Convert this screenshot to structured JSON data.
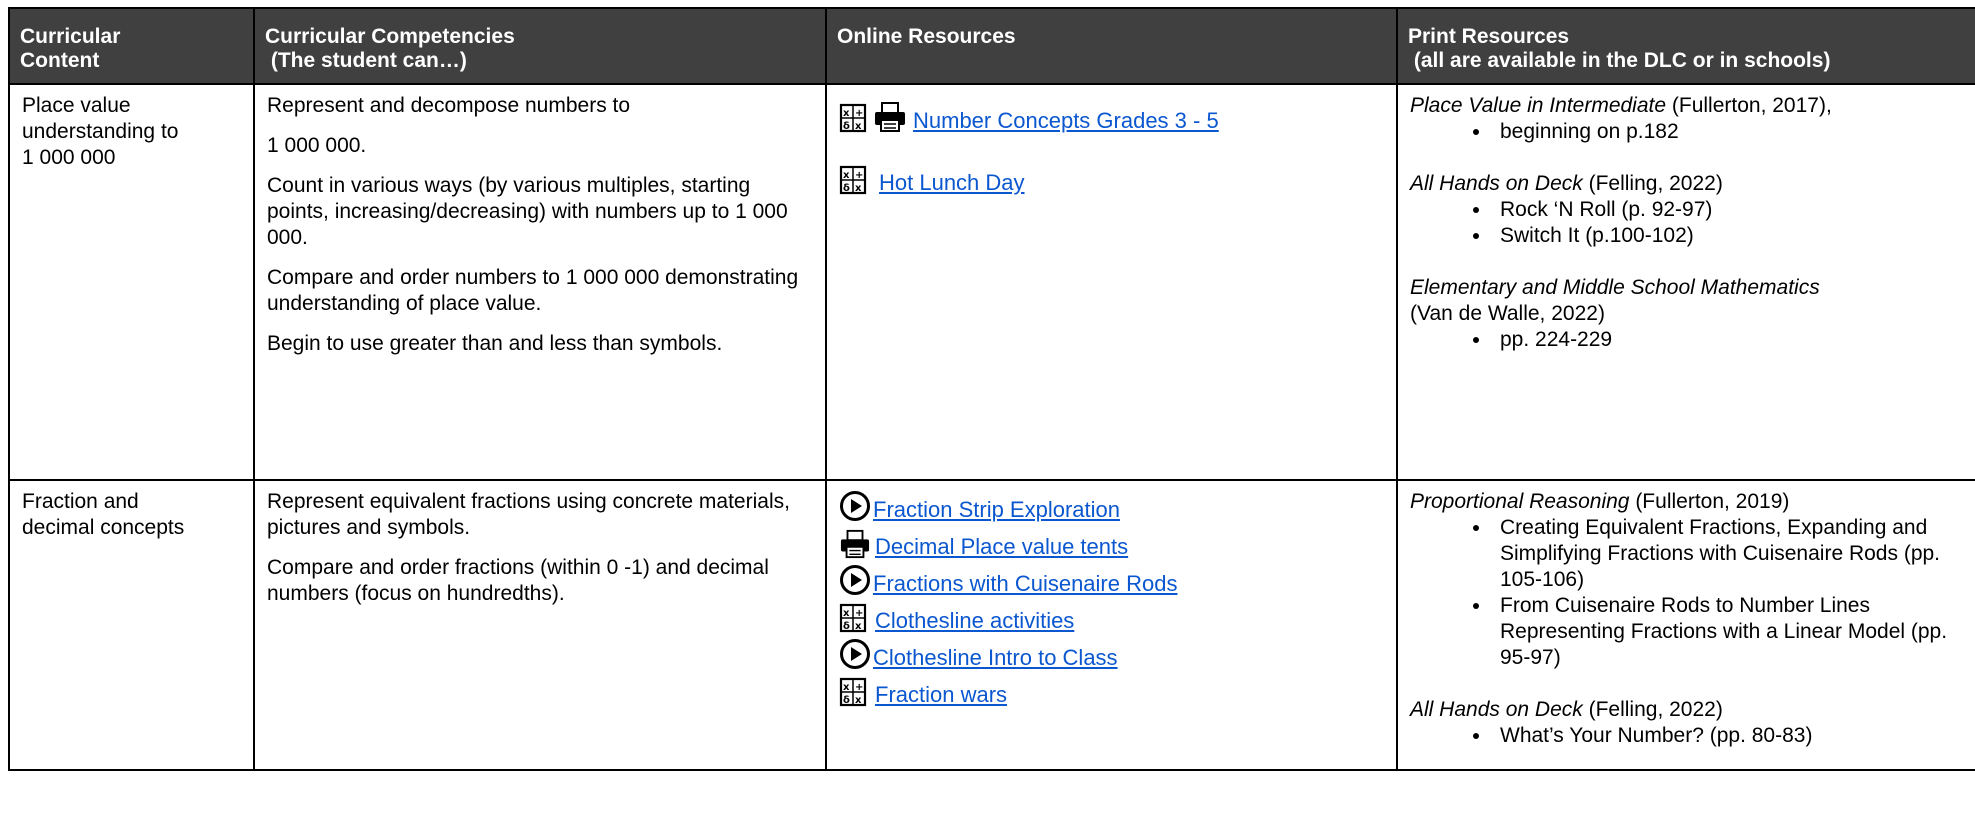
{
  "headers": {
    "content_l1": "Curricular",
    "content_l2": "Content",
    "competencies_l1": "Curricular Competencies",
    "competencies_l2": " (The student can…)",
    "online": "Online Resources",
    "print_l1": "Print Resources",
    "print_l2": " (all are available in the DLC or in schools)"
  },
  "row1": {
    "content_l1": "Place value",
    "content_l2": "understanding to",
    "content_l3": "1 000 000",
    "competencies": [
      "Represent and decompose numbers to",
      "1 000 000.",
      "Count in various ways (by various multiples, starting points, increasing/decreasing) with numbers up to 1 000 000.",
      "Compare and order numbers to 1 000 000 demonstrating understanding of place value.",
      "Begin to use greater than and less than symbols."
    ],
    "online": [
      {
        "icons": [
          "math-activity-icon",
          "printer-icon"
        ],
        "label": "Number Concepts Grades 3 - 5"
      },
      {
        "icons": [
          "math-activity-icon"
        ],
        "label": "Hot Lunch Day"
      }
    ],
    "print": [
      {
        "title": "Place Value in Intermediate",
        "citation": " (Fullerton, 2017),",
        "items": [
          "beginning on p.182"
        ]
      },
      {
        "title": "All Hands on Deck",
        "citation": " (Felling, 2022)",
        "items": [
          "Rock ‘N Roll (p. 92-97)",
          "Switch It (p.100-102)"
        ]
      },
      {
        "title": "Elementary and Middle School Mathematics",
        "citation": "(Van de Walle, 2022)",
        "items": [
          "pp. 224-229"
        ]
      }
    ]
  },
  "row2": {
    "content_l1": "Fraction and",
    "content_l2": "decimal concepts",
    "competencies": [
      "Represent equivalent fractions using concrete materials, pictures and symbols.",
      "Compare and order fractions (within 0 -1) and decimal numbers (focus on hundredths)."
    ],
    "online": [
      {
        "icons": [
          "play-video-icon"
        ],
        "label": "Fraction Strip Exploration"
      },
      {
        "icons": [
          "printer-icon"
        ],
        "label": "Decimal Place value tents"
      },
      {
        "icons": [
          "play-video-icon"
        ],
        "label": "Fractions with Cuisenaire Rods"
      },
      {
        "icons": [
          "math-activity-icon"
        ],
        "label": "Clothesline activities"
      },
      {
        "icons": [
          "play-video-icon"
        ],
        "label": "Clothesline Intro to Class"
      },
      {
        "icons": [
          "math-activity-icon"
        ],
        "label": "Fraction wars"
      }
    ],
    "print": [
      {
        "title": "Proportional Reasoning",
        "citation": " (Fullerton, 2019)",
        "items": [
          "Creating Equivalent Fractions, Expanding and Simplifying Fractions with Cuisenaire Rods (pp. 105-106)",
          "From Cuisenaire Rods to Number Lines Representing Fractions with a Linear Model (pp. 95-97)"
        ]
      },
      {
        "title": "All Hands on Deck",
        "citation": " (Felling, 2022)",
        "items": [
          "What’s Your Number? (pp. 80-83)"
        ]
      }
    ]
  }
}
